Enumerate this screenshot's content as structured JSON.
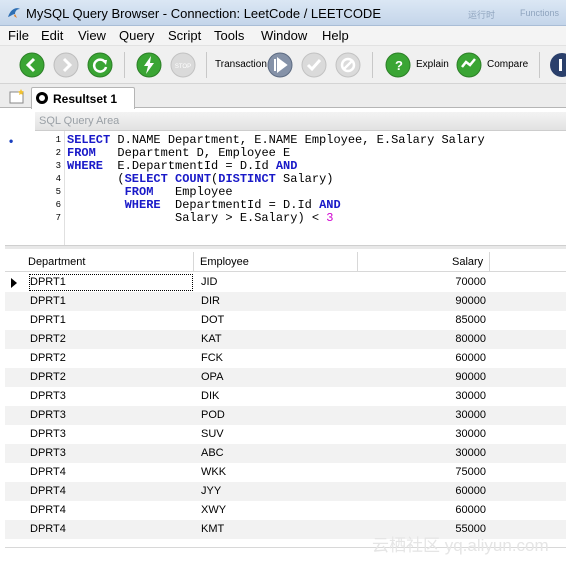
{
  "window": {
    "title": "MySQL Query Browser - Connection: LeetCode / LEETCODE",
    "ghost_text_1": "运行时",
    "ghost_text_2": "Functions"
  },
  "menu": [
    "File",
    "Edit",
    "View",
    "Query",
    "Script",
    "Tools",
    "Window",
    "Help"
  ],
  "toolbar": {
    "transaction_label": "Transaction",
    "explain_label": "Explain",
    "compare_label": "Compare",
    "icons": [
      "back-arrow-icon",
      "forward-arrow-icon",
      "refresh-icon",
      "execute-lightning-icon",
      "stop-icon",
      "transaction-start-icon",
      "commit-check-icon",
      "rollback-cancel-icon",
      "explain-icon",
      "compare-icon"
    ],
    "colors": {
      "green": "#3aa534",
      "disabled": "#c9c9c9",
      "dark": "#2a3f6b"
    }
  },
  "tabs": {
    "active_label": "Resultset 1"
  },
  "sql_area": {
    "header": "SQL Query Area",
    "marker": "•",
    "lines": [
      {
        "n": "1",
        "segments": [
          {
            "t": "SELECT",
            "c": "kw"
          },
          {
            "t": " D.NAME Department, E.NAME Employee, E.Salary Salary",
            "c": ""
          }
        ]
      },
      {
        "n": "2",
        "segments": [
          {
            "t": "FROM",
            "c": "kw"
          },
          {
            "t": "   Department D, Employee E",
            "c": ""
          }
        ]
      },
      {
        "n": "3",
        "segments": [
          {
            "t": "WHERE",
            "c": "kw"
          },
          {
            "t": "  E.DepartmentId = D.Id ",
            "c": ""
          },
          {
            "t": "AND",
            "c": "kw"
          }
        ]
      },
      {
        "n": "4",
        "segments": [
          {
            "t": "       (",
            "c": ""
          },
          {
            "t": "SELECT",
            "c": "kw"
          },
          {
            "t": " ",
            "c": ""
          },
          {
            "t": "COUNT",
            "c": "kw"
          },
          {
            "t": "(",
            "c": ""
          },
          {
            "t": "DISTINCT",
            "c": "kw"
          },
          {
            "t": " Salary)",
            "c": ""
          }
        ]
      },
      {
        "n": "5",
        "segments": [
          {
            "t": "        ",
            "c": ""
          },
          {
            "t": "FROM",
            "c": "kw"
          },
          {
            "t": "   Employee",
            "c": ""
          }
        ]
      },
      {
        "n": "6",
        "segments": [
          {
            "t": "        ",
            "c": ""
          },
          {
            "t": "WHERE",
            "c": "kw"
          },
          {
            "t": "  DepartmentId = D.Id ",
            "c": ""
          },
          {
            "t": "AND",
            "c": "kw"
          }
        ]
      },
      {
        "n": "7",
        "segments": [
          {
            "t": "               Salary > E.Salary) < ",
            "c": ""
          },
          {
            "t": "3",
            "c": "num"
          }
        ]
      }
    ]
  },
  "grid": {
    "columns": [
      "Department",
      "Employee",
      "Salary"
    ],
    "rows": [
      [
        "DPRT1",
        "JID",
        "70000"
      ],
      [
        "DPRT1",
        "DIR",
        "90000"
      ],
      [
        "DPRT1",
        "DOT",
        "85000"
      ],
      [
        "DPRT2",
        "KAT",
        "80000"
      ],
      [
        "DPRT2",
        "FCK",
        "60000"
      ],
      [
        "DPRT2",
        "OPA",
        "90000"
      ],
      [
        "DPRT3",
        "DIK",
        "30000"
      ],
      [
        "DPRT3",
        "POD",
        "30000"
      ],
      [
        "DPRT3",
        "SUV",
        "30000"
      ],
      [
        "DPRT3",
        "ABC",
        "30000"
      ],
      [
        "DPRT4",
        "WKK",
        "75000"
      ],
      [
        "DPRT4",
        "JYY",
        "60000"
      ],
      [
        "DPRT4",
        "XWY",
        "60000"
      ],
      [
        "DPRT4",
        "KMT",
        "55000"
      ]
    ]
  },
  "watermark": "云栖社区 yq.aliyun.com"
}
